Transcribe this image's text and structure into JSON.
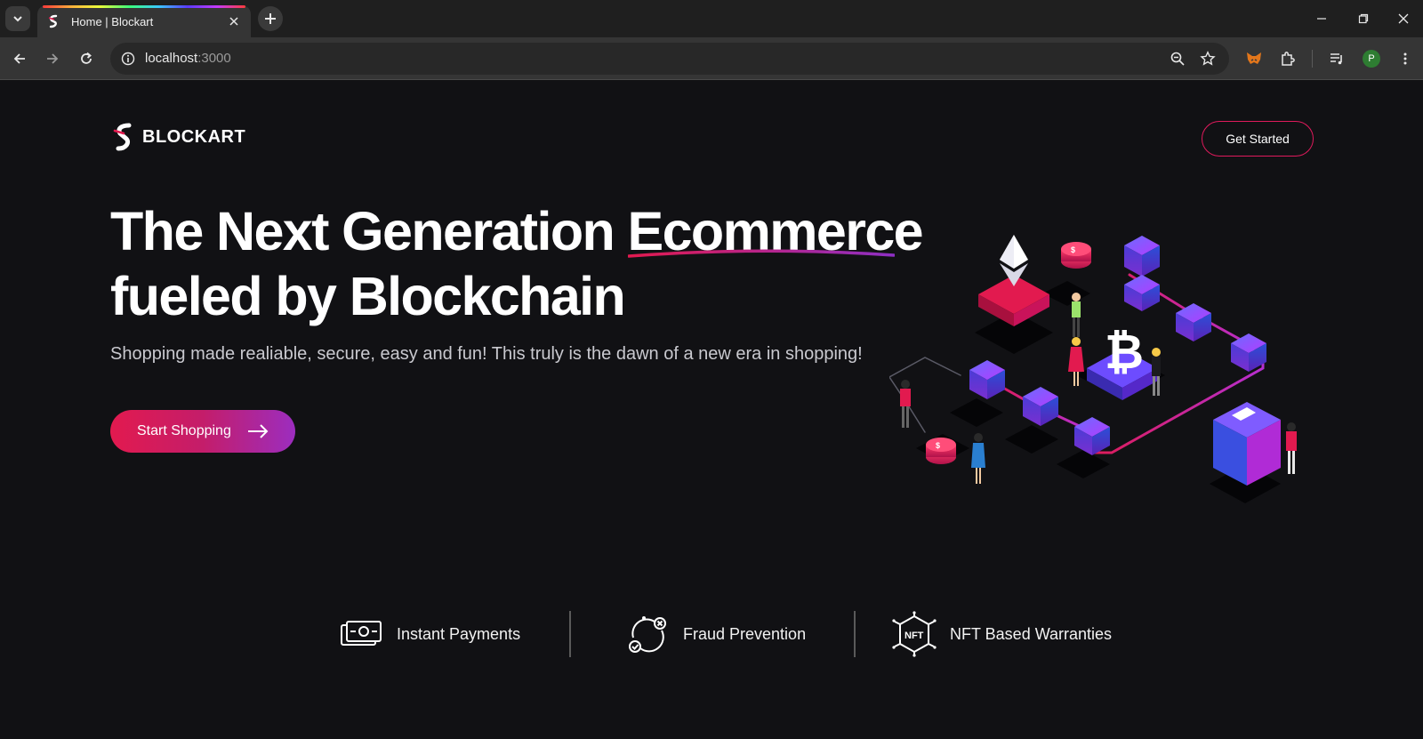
{
  "browser": {
    "tab_title": "Home | Blockart",
    "url_host": "localhost",
    "url_port": ":3000",
    "avatar_letter": "P"
  },
  "header": {
    "logo_text": "BLOCKART",
    "cta_label": "Get Started"
  },
  "hero": {
    "headline_part1": "The Next Generation ",
    "headline_highlight": "Ecommerce",
    "headline_line2": "fueled by Blockchain",
    "subtitle": "Shopping made realiable, secure, easy and fun! This truly is the dawn of a new era in shopping!",
    "cta_label": "Start Shopping"
  },
  "features": [
    {
      "label": "Instant Payments",
      "icon": "cash-payment-icon"
    },
    {
      "label": "Fraud Prevention",
      "icon": "fraud-shield-icon"
    },
    {
      "label": "NFT Based Warranties",
      "icon": "nft-badge-icon"
    }
  ],
  "colors": {
    "background": "#111114",
    "accent": "#e21a4f",
    "accent_purple": "#9c2dbf"
  }
}
